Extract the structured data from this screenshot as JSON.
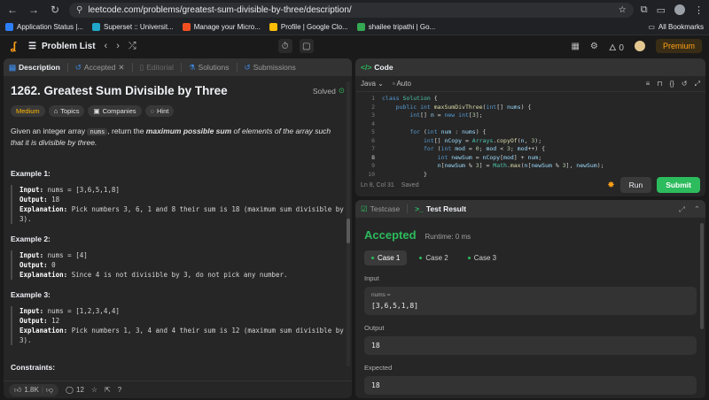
{
  "browser": {
    "url": "leetcode.com/problems/greatest-sum-divisible-by-three/description/",
    "bookmarks": [
      {
        "label": "Application Status |...",
        "color": "#2d7ff9"
      },
      {
        "label": "Superset :: Universit...",
        "color": "#20a7c9"
      },
      {
        "label": "Manage your Micro...",
        "color": "#f25022"
      },
      {
        "label": "Profile | Google Clo...",
        "color": "#fbbc05"
      },
      {
        "label": "shailee tripathi | Go...",
        "color": "#34a853"
      }
    ],
    "all_bookmarks": "All Bookmarks"
  },
  "header": {
    "problem_list": "Problem List",
    "coins": "0",
    "premium": "Premium"
  },
  "left_tabs": [
    {
      "label": "Description"
    },
    {
      "label": "Accepted"
    },
    {
      "label": "Editorial"
    },
    {
      "label": "Solutions"
    },
    {
      "label": "Submissions"
    }
  ],
  "problem": {
    "title": "1262. Greatest Sum Divisible by Three",
    "status": "Solved",
    "chips": {
      "difficulty": "Medium",
      "topics": "Topics",
      "companies": "Companies",
      "hint": "Hint"
    },
    "desc_pre": "Given an integer array ",
    "desc_code": "nums",
    "desc_mid": ", return the ",
    "desc_bold": "maximum possible sum",
    "desc_post": " of elements of the array such that it is divisible by three.",
    "examples": [
      {
        "title": "Example 1:",
        "input": "nums = [3,6,5,1,8]",
        "output": "18",
        "explanation": "Pick numbers 3, 6, 1 and 8 their sum is 18 (maximum sum divisible by 3)."
      },
      {
        "title": "Example 2:",
        "input": "nums = [4]",
        "output": "0",
        "explanation": "Since 4 is not divisible by 3, do not pick any number."
      },
      {
        "title": "Example 3:",
        "input": "nums = [1,2,3,4,4]",
        "output": "12",
        "explanation": "Pick numbers 1, 3, 4 and 4 their sum is 12 (maximum sum divisible by 3)."
      }
    ],
    "labels": {
      "input": "Input:",
      "output": "Output:",
      "explanation": "Explanation:"
    },
    "constraints": "Constraints:",
    "likes": "1.8K",
    "comments": "12"
  },
  "code_panel": {
    "title": "Code",
    "language": "Java",
    "mode": "Auto",
    "status": "Ln 8, Col 31",
    "saved": "Saved",
    "run": "Run",
    "submit": "Submit",
    "line_numbers": [
      "1",
      "2",
      "3",
      "4",
      "5",
      "6",
      "7",
      "8",
      "9",
      "10"
    ]
  },
  "result_panel": {
    "testcase_tab": "Testcase",
    "result_tab": "Test Result",
    "verdict": "Accepted",
    "runtime": "Runtime: 0 ms",
    "cases": [
      "Case 1",
      "Case 2",
      "Case 3"
    ],
    "input_label": "Input",
    "input_var": "nums =",
    "input_value": "[3,6,5,1,8]",
    "output_label": "Output",
    "output_value": "18",
    "expected_label": "Expected",
    "expected_value": "18"
  },
  "colors": {
    "accent": "#ffa116",
    "accepted": "#2cbb5d",
    "medium": "#ffb800",
    "tab_blue": "#3c8be8"
  }
}
